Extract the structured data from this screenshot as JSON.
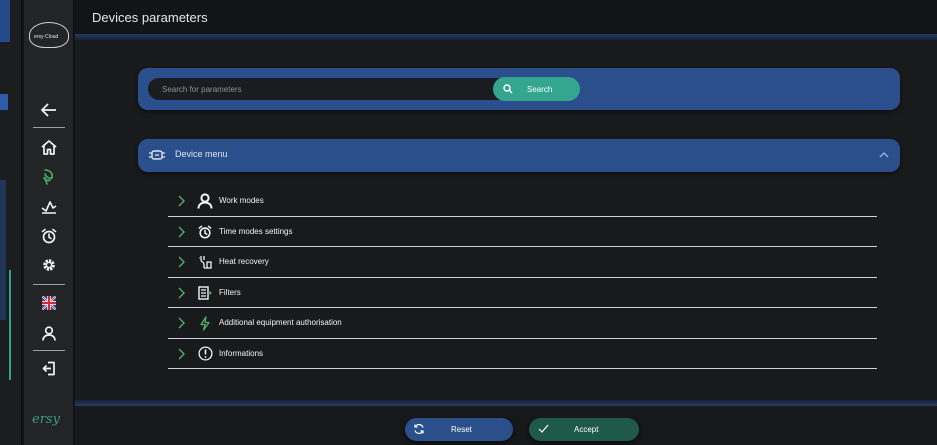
{
  "header": {
    "title": "Devices parameters"
  },
  "sidebar": {
    "logo_top_text": "ersy·Cloud",
    "logo_bottom_text": "ersy",
    "items": [
      {
        "name": "back-arrow-icon"
      },
      {
        "name": "home-icon"
      },
      {
        "name": "leaf-hand-icon"
      },
      {
        "name": "chart-trend-icon"
      },
      {
        "name": "alarm-clock-icon"
      },
      {
        "name": "gear-icon"
      },
      {
        "name": "uk-flag-icon"
      },
      {
        "name": "user-icon"
      },
      {
        "name": "logout-icon"
      }
    ]
  },
  "search": {
    "placeholder": "Search for parameters",
    "button_label": "Search"
  },
  "accordion": {
    "label": "Device menu"
  },
  "menu": {
    "items": [
      {
        "label": "Work modes",
        "icon": "user-icon"
      },
      {
        "label": "Time modes settings",
        "icon": "alarm-clock-icon"
      },
      {
        "label": "Heat recovery",
        "icon": "heat-exchanger-icon"
      },
      {
        "label": "Filters",
        "icon": "filter-icon"
      },
      {
        "label": "Additional equipment authorisation",
        "icon": "lightning-icon"
      },
      {
        "label": "Informations",
        "icon": "info-circle-icon"
      }
    ]
  },
  "footer": {
    "reset_label": "Reset",
    "accept_label": "Accept"
  },
  "colors": {
    "accent_blue": "#2b4f8b",
    "accent_green": "#34a58f",
    "icon_green": "#4fb06b"
  }
}
